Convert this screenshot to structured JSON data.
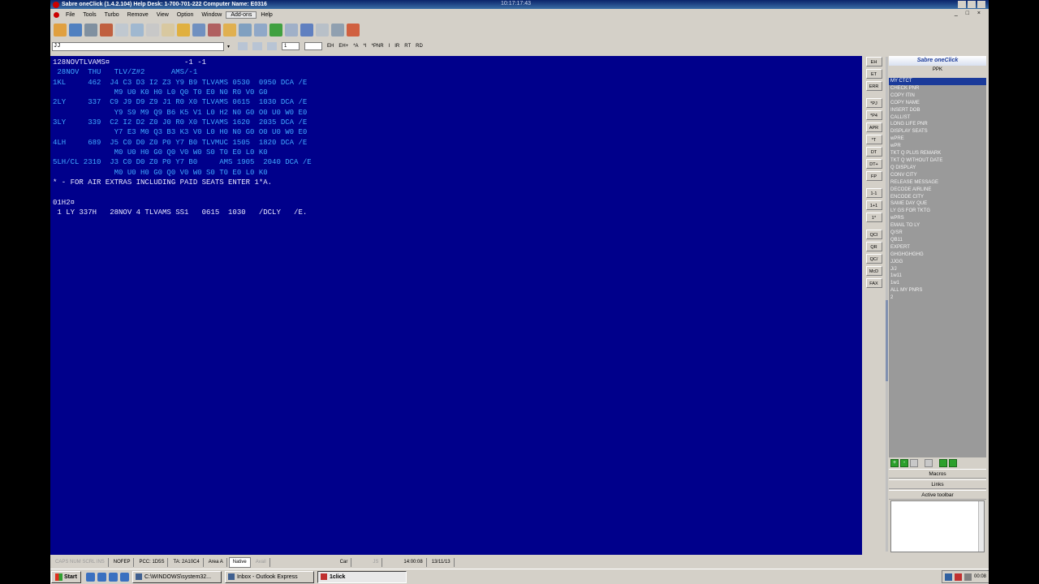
{
  "window": {
    "title": "Sabre oneClick (1.4.2.104)   Help Desk: 1-700-701-222   Computer Name: E0316",
    "time": "10:17:17:43"
  },
  "menu": [
    "File",
    "Tools",
    "Turbo",
    "Remove",
    "View",
    "Option",
    "Window",
    "Add-ons",
    "Help"
  ],
  "command_input": "JJ",
  "toolbar2": {
    "select1": "1",
    "items": [
      "EH",
      "EH+",
      "*A",
      "*I",
      "*PNR",
      "I",
      "IR",
      "RT",
      "RD"
    ]
  },
  "terminal": {
    "lines": [
      {
        "text": "128NOVTLVAMS¤                 -1 -1",
        "style": "white"
      },
      {
        "text": " 28NOV  THU   TLV/Z#2      AMS/-1",
        "style": "blue"
      },
      {
        "text": "1KL     462  J4 C3 D3 I2 Z3 Y9 B9 TLVAMS 0530  0950 DCA /E",
        "style": "blue"
      },
      {
        "text": "              M9 U0 K0 H0 L0 Q0 T0 E0 N0 R0 V0 G0",
        "style": "blue"
      },
      {
        "text": "2LY     337  C9 J9 D9 Z9 J1 R0 X0 TLVAMS 0615  1030 DCA /E",
        "style": "blue"
      },
      {
        "text": "              Y9 S9 M9 Q9 B6 K5 V1 L0 H2 N0 G0 O0 U0 W0 E0",
        "style": "blue"
      },
      {
        "text": "3LY     339  C2 I2 D2 Z0 J0 R0 X0 TLVAMS 1620  2035 DCA /E",
        "style": "blue"
      },
      {
        "text": "              Y7 E3 M0 Q3 B3 K3 V0 L0 H0 N0 G0 O0 U0 W0 E0",
        "style": "blue"
      },
      {
        "text": "4LH     689  J5 C0 D0 Z0 P0 Y7 B0 TLVMUC 1505  1820 DCA /E",
        "style": "blue"
      },
      {
        "text": "              M0 U0 H0 G0 Q0 V0 W0 S0 T0 E0 L0 K0",
        "style": "blue"
      },
      {
        "text": "5LH/CL 2310  J3 C0 D0 Z0 P0 Y7 B0     AMS 1905  2040 DCA /E",
        "style": "blue"
      },
      {
        "text": "              M0 U0 H0 G0 Q0 V0 W0 S0 T0 E0 L0 K0",
        "style": "blue"
      },
      {
        "text": "* - FOR AIR EXTRAS INCLUDING PAID SEATS ENTER 1*A.",
        "style": "white"
      },
      {
        "text": "",
        "style": "blue"
      },
      {
        "text": "01H2¤",
        "style": "white"
      },
      {
        "text": " 1 LY 337H   28NOV 4 TLVAMS SS1   0615  1030   /DCLY   /E.",
        "style": "white"
      }
    ]
  },
  "side_buttons": [
    "EH",
    "ET",
    "ERR",
    "*PJ",
    "*P4",
    "APR",
    "*T",
    "DT",
    "DT+",
    "FP",
    "1-1",
    "1+1",
    "1*",
    "QCI",
    "QR",
    "QC/",
    "McD",
    "FAX"
  ],
  "panel": {
    "title": "Sabre oneClick",
    "subtitle": "PPK",
    "macros": [
      "MY CTCT",
      "CHECK PNR",
      "COPY ITIN",
      "COPY NAME",
      "INSERT DOB",
      "CALLIST",
      "LONG LIFE PNR",
      "DISPLAY SEATS",
      "wPRE",
      "wPR",
      "TKT Q PLUS REMARK",
      "TKT Q WITHOUT DATE",
      "Q DISPLAY",
      "CONV CITY",
      "RELEASE MESSAGE",
      "DECODE AIRLINE",
      "ENCODE CITY",
      "SAME DAY QUE",
      "LY GS FOR TKTG",
      "wPRS",
      "EMAIL TO LY",
      "Q/SR",
      "QB11",
      "EXPERT",
      "GHGHGHGHG",
      "JJGG",
      "J/J",
      "1w11",
      "1w1",
      "ALL MY PNRS",
      "2"
    ],
    "sections": [
      "Macros",
      "Links",
      "Active toolbar"
    ]
  },
  "statusbar": {
    "cells": [
      {
        "text": "CAPS  NUM  SCRL  INS",
        "style": "dim"
      },
      {
        "text": "NOFEP",
        "style": "normal"
      },
      {
        "text": "PCC: 1D5S",
        "style": "normal"
      },
      {
        "text": "TA: 2A10C4",
        "style": "normal"
      },
      {
        "text": "Area A",
        "style": "normal"
      },
      {
        "text": "Native",
        "style": "native"
      },
      {
        "text": "Avail",
        "style": "dim"
      },
      {
        "text": "Car",
        "style": "normal"
      },
      {
        "text": "JS",
        "style": "dim"
      },
      {
        "text": "14:00:08",
        "style": "normal"
      },
      {
        "text": "13/11/13",
        "style": "normal"
      }
    ]
  },
  "taskbar": {
    "start": "Start",
    "tasks": [
      {
        "label": "C:\\WINDOWS\\system32...",
        "active": false
      },
      {
        "label": "Inbox - Outlook Express",
        "active": false
      },
      {
        "label": "1click",
        "active": true
      }
    ],
    "clock": "00:08"
  },
  "colors": {
    "terminal_bg": "#00008b",
    "terminal_text": "#3fa8ff",
    "terminal_text_bright": "#e8e8ff",
    "panel_list_bg": "#9a9a9a",
    "title_bar": "#0a246a"
  }
}
